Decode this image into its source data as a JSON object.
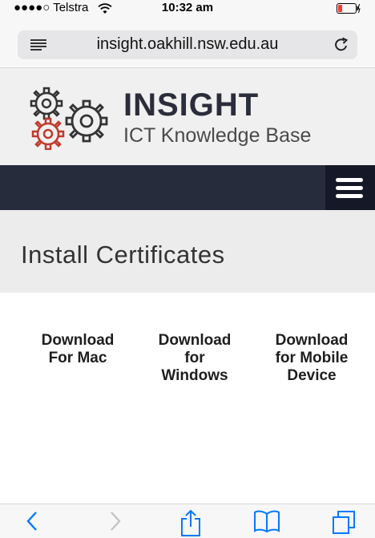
{
  "status_bar": {
    "carrier": "●●●●○ Telstra",
    "time": "10:32 am",
    "battery_level": 0.2,
    "battery_color": "#ff3b30"
  },
  "browser": {
    "url": "insight.oakhill.nsw.edu.au"
  },
  "site": {
    "title": "INSIGHT",
    "subtitle": "ICT Knowledge Base",
    "nav_color": "#272c3d",
    "accent_gear_color": "#c0392b"
  },
  "page": {
    "heading": "Install Certificates",
    "downloads": [
      {
        "line1": "Download",
        "line2": "For Mac",
        "line3": ""
      },
      {
        "line1": "Download",
        "line2": "for",
        "line3": "Windows"
      },
      {
        "line1": "Download",
        "line2": "for Mobile",
        "line3": "Device"
      }
    ]
  },
  "toolbar": {
    "icons": [
      "back-icon",
      "forward-icon",
      "share-icon",
      "bookmarks-icon",
      "tabs-icon"
    ],
    "tint_color": "#007aff"
  }
}
